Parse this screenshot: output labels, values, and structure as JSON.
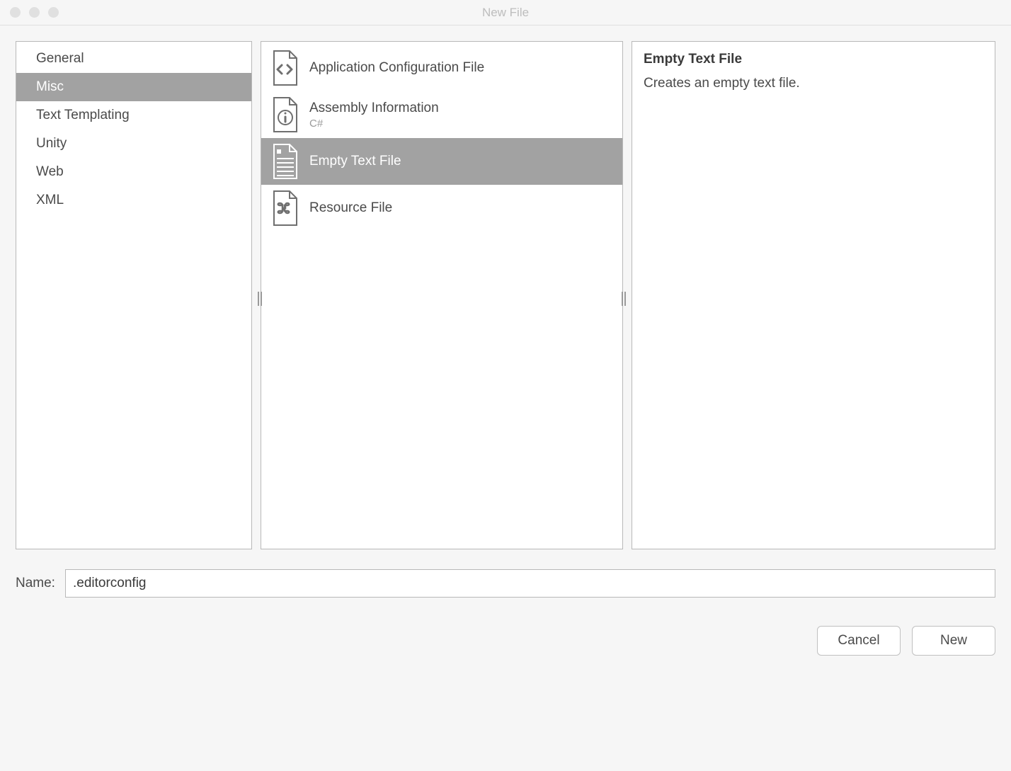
{
  "window": {
    "title": "New File"
  },
  "categories": [
    {
      "label": "General",
      "selected": false
    },
    {
      "label": "Misc",
      "selected": true
    },
    {
      "label": "Text Templating",
      "selected": false
    },
    {
      "label": "Unity",
      "selected": false
    },
    {
      "label": "Web",
      "selected": false
    },
    {
      "label": "XML",
      "selected": false
    }
  ],
  "templates": [
    {
      "label": "Application Configuration File",
      "sub": "",
      "icon": "code-file-icon",
      "selected": false
    },
    {
      "label": "Assembly Information",
      "sub": "C#",
      "icon": "info-file-icon",
      "selected": false
    },
    {
      "label": "Empty Text File",
      "sub": "",
      "icon": "text-file-icon",
      "selected": true
    },
    {
      "label": "Resource File",
      "sub": "",
      "icon": "command-file-icon",
      "selected": false
    }
  ],
  "description": {
    "title": "Empty Text File",
    "body": "Creates an empty text file."
  },
  "name_field": {
    "label": "Name:",
    "value": ".editorconfig"
  },
  "buttons": {
    "cancel": "Cancel",
    "new": "New"
  }
}
